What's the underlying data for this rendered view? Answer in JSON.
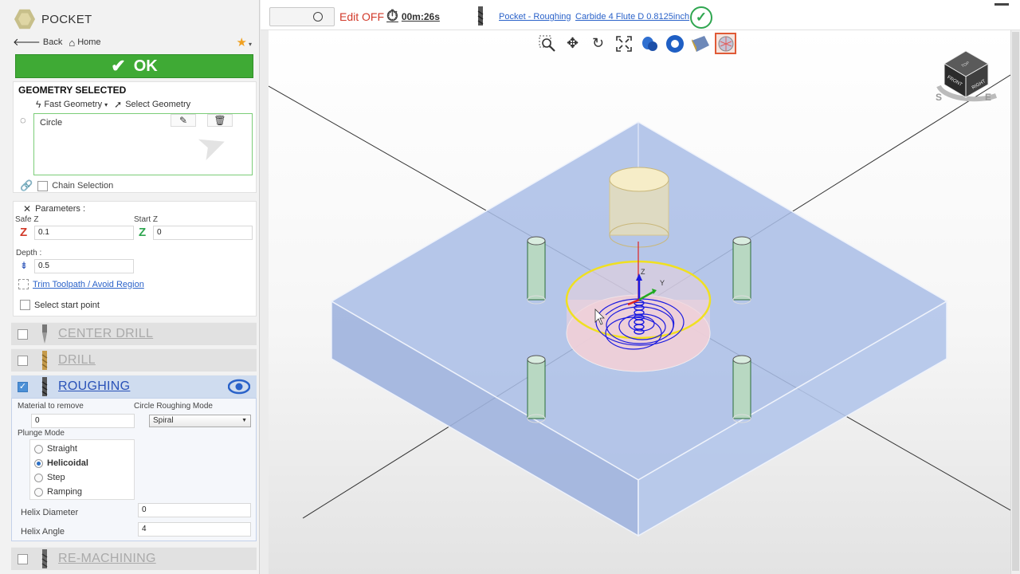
{
  "panel": {
    "title": "POCKET",
    "nav": {
      "back": "Back",
      "home": "Home"
    },
    "ok_label": "OK",
    "geometry": {
      "title": "GEOMETRY SELECTED",
      "fast_geometry": "Fast Geometry",
      "select_geometry": "Select Geometry",
      "items": [
        "Circle"
      ],
      "chain_selection": "Chain Selection"
    },
    "parameters": {
      "title": "Parameters :",
      "safe_z_label": "Safe Z",
      "safe_z": "0.1",
      "start_z_label": "Start Z",
      "start_z": "0",
      "depth_label": "Depth :",
      "depth": "0.5",
      "trim_link": "Trim Toolpath / Avoid Region",
      "start_point": "Select start point"
    },
    "operations": [
      {
        "label": "CENTER DRILL",
        "checked": false
      },
      {
        "label": "DRILL",
        "checked": false
      },
      {
        "label": "ROUGHING",
        "checked": true
      },
      {
        "label": "RE-MACHINING",
        "checked": false
      }
    ],
    "roughing": {
      "material_label": "Material to remove",
      "material_value": "0",
      "circle_mode_label": "Circle Roughing Mode",
      "circle_mode_value": "Spiral",
      "plunge_label": "Plunge Mode",
      "plunge_options": [
        "Straight",
        "Helicoidal",
        "Step",
        "Ramping"
      ],
      "plunge_selected": "Helicoidal",
      "helix_diameter_label": "Helix Diameter",
      "helix_diameter": "0",
      "helix_angle_label": "Helix Angle",
      "helix_angle": "4"
    }
  },
  "topbar": {
    "edit_label": "Edit OFF",
    "timer": "00m:26s",
    "operation_link": "Pocket - Roughing",
    "tool_link": "Carbide 4 Flute D 0.8125inch"
  },
  "viewport": {
    "toolbar_icons": [
      "zoom-window-icon",
      "pan-icon",
      "rotate-icon",
      "fit-view-icon",
      "tool-view-icon",
      "stock-view-icon",
      "part-view-icon",
      "wireframe-view-icon"
    ],
    "view_cube": {
      "top": "TOP",
      "front": "FRONT",
      "right": "RIGHT",
      "south": "S",
      "east": "E"
    },
    "axes": {
      "z": "Z",
      "y": "Y"
    }
  },
  "colors": {
    "ok_green": "#3faa35",
    "edit_red": "#d23a2a",
    "link_blue": "#2a62c9",
    "stock_blue": "#8ea8d8",
    "contour_yellow": "#f0e020",
    "toolpath_blue": "#1a1ae0"
  }
}
